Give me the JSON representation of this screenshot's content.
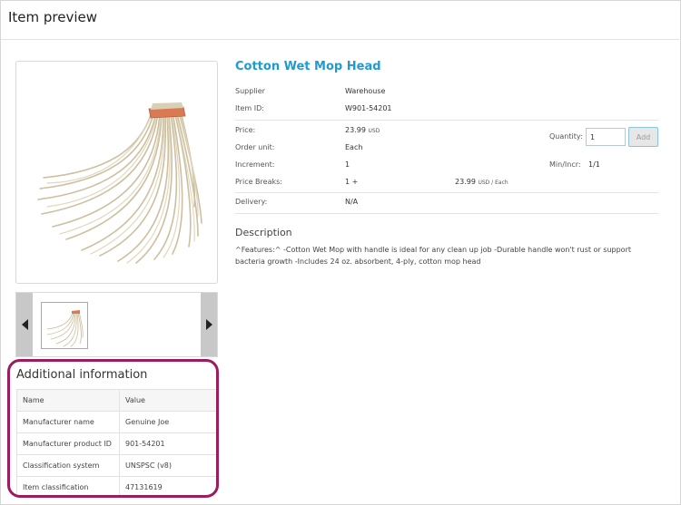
{
  "header": {
    "title": "Item preview"
  },
  "product": {
    "name": "Cotton Wet Mop Head",
    "image_icon": "mop-head-icon"
  },
  "details": {
    "supplier_label": "Supplier",
    "supplier_value": "Warehouse",
    "item_id_label": "Item ID:",
    "item_id_value": "W901-54201",
    "price_label": "Price:",
    "price_value": "23.99",
    "price_currency": "USD",
    "order_unit_label": "Order unit:",
    "order_unit_value": "Each",
    "increment_label": "Increment:",
    "increment_value": "1",
    "price_breaks_label": "Price Breaks:",
    "price_breaks_qty": "1 +",
    "price_breaks_price": "23.99",
    "price_breaks_unit": "USD / Each",
    "delivery_label": "Delivery:",
    "delivery_value": "N/A"
  },
  "order": {
    "quantity_label": "Quantity:",
    "quantity_value": "1",
    "add_label": "Add",
    "min_incr_label": "Min/Incr:",
    "min_incr_value": "1/1"
  },
  "description": {
    "title": "Description",
    "text": "^Features:^ -Cotton Wet Mop with handle is ideal for any clean up job -Durable handle won't rust or support bacteria growth -Includes 24 oz. absorbent, 4-ply, cotton mop head"
  },
  "additional": {
    "title": "Additional information",
    "headers": [
      "Name",
      "Value"
    ],
    "rows": [
      [
        "Manufacturer name",
        "Genuine Joe"
      ],
      [
        "Manufacturer product ID",
        "901-54201"
      ],
      [
        "Classification system",
        "UNSPSC (v8)"
      ],
      [
        "Item classification",
        "47131619"
      ]
    ]
  },
  "colors": {
    "accent": "#1f9bd1",
    "highlight": "#9c1c5e",
    "mop_cord": "#d6c9ab",
    "mop_band": "#d97a52"
  }
}
